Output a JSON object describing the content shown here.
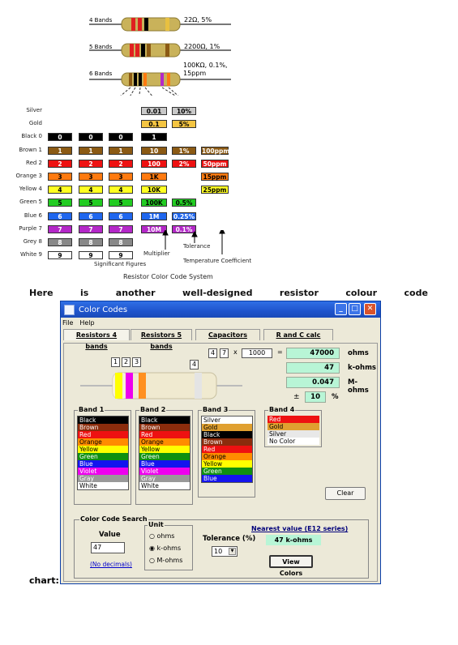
{
  "figure": {
    "bands_rows": [
      {
        "label": "4 Bands",
        "value": "22Ω, 5%"
      },
      {
        "label": "5 Bands",
        "value": "2200Ω, 1%"
      },
      {
        "label": "6 Bands",
        "value": "100KΩ, 0.1%, 15ppm"
      }
    ],
    "table_rows": [
      {
        "label": "Silver",
        "color": "#c8c8c8",
        "sig": [
          "",
          "",
          ""
        ],
        "mult": "0.01",
        "tol": "10%",
        "tc": ""
      },
      {
        "label": "Gold",
        "color": "#f4c542",
        "sig": [
          "",
          "",
          ""
        ],
        "mult": "0.1",
        "tol": "5%",
        "tc": ""
      },
      {
        "label": "Black 0",
        "color": "#000000",
        "sig": [
          "0",
          "0",
          "0"
        ],
        "mult": "1",
        "tol": "",
        "tc": ""
      },
      {
        "label": "Brown 1",
        "color": "#8b5a14",
        "sig": [
          "1",
          "1",
          "1"
        ],
        "mult": "10",
        "tol": "1%",
        "tc": "100ppm"
      },
      {
        "label": "Red 2",
        "color": "#ee1111",
        "sig": [
          "2",
          "2",
          "2"
        ],
        "mult": "100",
        "tol": "2%",
        "tc": "50ppm"
      },
      {
        "label": "Orange 3",
        "color": "#ff7a10",
        "sig": [
          "3",
          "3",
          "3"
        ],
        "mult": "1K",
        "tol": "",
        "tc": "15ppm"
      },
      {
        "label": "Yellow 4",
        "color": "#ffff22",
        "sig": [
          "4",
          "4",
          "4"
        ],
        "mult": "10K",
        "tol": "",
        "tc": "25ppm"
      },
      {
        "label": "Green 5",
        "color": "#22cc22",
        "sig": [
          "5",
          "5",
          "5"
        ],
        "mult": "100K",
        "tol": "0.5%",
        "tc": ""
      },
      {
        "label": "Blue 6",
        "color": "#1f66ee",
        "sig": [
          "6",
          "6",
          "6"
        ],
        "mult": "1M",
        "tol": "0.25%",
        "tc": ""
      },
      {
        "label": "Purple 7",
        "color": "#b428c8",
        "sig": [
          "7",
          "7",
          "7"
        ],
        "mult": "10M",
        "tol": "0.1%",
        "tc": ""
      },
      {
        "label": "Grey 8",
        "color": "#888888",
        "sig": [
          "8",
          "8",
          "8"
        ],
        "mult": "",
        "tol": "",
        "tc": ""
      },
      {
        "label": "White 9",
        "color": "#ffffff",
        "sig": [
          "9",
          "9",
          "9"
        ],
        "mult": "",
        "tol": "",
        "tc": ""
      }
    ],
    "captions": {
      "significant": "Significant Figures",
      "multiplier": "Multiplier",
      "tolerance": "Tolerance",
      "temp": "Temperature Coefficient",
      "system": "Resistor Color Code System"
    }
  },
  "paragraph": {
    "words": [
      "Here",
      "is",
      "another",
      "well-designed",
      "resistor",
      "colour",
      "code"
    ],
    "last": "chart:"
  },
  "window": {
    "title": "Color Codes",
    "menu": [
      "File",
      "Help"
    ],
    "tabs": [
      "Resistors 4 bands",
      "Resistors 5 bands",
      "Capacitors",
      "R and C calc"
    ],
    "band_numbers": [
      "1",
      "2",
      "3",
      "4"
    ],
    "digits": [
      "4",
      "7"
    ],
    "times": "x",
    "multiplier": "1000",
    "equals": "=",
    "results": [
      {
        "value": "47000",
        "unit": "ohms"
      },
      {
        "value": "47",
        "unit": "k-ohms"
      },
      {
        "value": "0.047",
        "unit": "M-ohms"
      }
    ],
    "plusminus": "±",
    "tolerance_value": "10",
    "percent": "%",
    "band1": {
      "title": "Band 1",
      "items": [
        {
          "name": "Black",
          "bg": "#000000",
          "fg": "#ffffff"
        },
        {
          "name": "Brown",
          "bg": "#8b2c0c",
          "fg": "#ffffff"
        },
        {
          "name": "Red",
          "bg": "#ee1111",
          "fg": "#ffffff"
        },
        {
          "name": "Orange",
          "bg": "#ff8c00",
          "fg": "#000000"
        },
        {
          "name": "Yellow",
          "bg": "#ffff00",
          "fg": "#000000"
        },
        {
          "name": "Green",
          "bg": "#109010",
          "fg": "#ffffff"
        },
        {
          "name": "Blue",
          "bg": "#1414ee",
          "fg": "#ffffff"
        },
        {
          "name": "Violet",
          "bg": "#ee00ee",
          "fg": "#ffffff"
        },
        {
          "name": "Gray",
          "bg": "#999999",
          "fg": "#ffffff"
        },
        {
          "name": "White",
          "bg": "#ffffff",
          "fg": "#000000"
        }
      ]
    },
    "band2": {
      "title": "Band 2",
      "items": [
        {
          "name": "Black",
          "bg": "#000000",
          "fg": "#ffffff"
        },
        {
          "name": "Brown",
          "bg": "#8b2c0c",
          "fg": "#ffffff"
        },
        {
          "name": "Red",
          "bg": "#ee1111",
          "fg": "#ffffff"
        },
        {
          "name": "Orange",
          "bg": "#ff8c00",
          "fg": "#000000"
        },
        {
          "name": "Yellow",
          "bg": "#ffff00",
          "fg": "#000000"
        },
        {
          "name": "Green",
          "bg": "#109010",
          "fg": "#ffffff"
        },
        {
          "name": "Blue",
          "bg": "#1414ee",
          "fg": "#ffffff"
        },
        {
          "name": "Violet",
          "bg": "#ee00ee",
          "fg": "#ffffff"
        },
        {
          "name": "Gray",
          "bg": "#999999",
          "fg": "#ffffff"
        },
        {
          "name": "White",
          "bg": "#ffffff",
          "fg": "#000000"
        }
      ]
    },
    "band3": {
      "title": "Band 3",
      "items": [
        {
          "name": "Silver",
          "bg": "#ffffff",
          "fg": "#000000"
        },
        {
          "name": "Gold",
          "bg": "#e0a030",
          "fg": "#000000"
        },
        {
          "name": "Black",
          "bg": "#000000",
          "fg": "#ffffff"
        },
        {
          "name": "Brown",
          "bg": "#8b2c0c",
          "fg": "#ffffff"
        },
        {
          "name": "Red",
          "bg": "#ee1111",
          "fg": "#ffffff"
        },
        {
          "name": "Orange",
          "bg": "#ff8c00",
          "fg": "#000000"
        },
        {
          "name": "Yellow",
          "bg": "#ffff00",
          "fg": "#000000"
        },
        {
          "name": "Green",
          "bg": "#109010",
          "fg": "#ffffff"
        },
        {
          "name": "Blue",
          "bg": "#1414ee",
          "fg": "#ffffff"
        }
      ]
    },
    "band4": {
      "title": "Band 4",
      "items": [
        {
          "name": "Red",
          "bg": "#ee1111",
          "fg": "#ffffff"
        },
        {
          "name": "Gold",
          "bg": "#e0a030",
          "fg": "#000000"
        },
        {
          "name": "Silver",
          "bg": "#e8e8e8",
          "fg": "#000000"
        },
        {
          "name": "No Color",
          "bg": "#ffffff",
          "fg": "#000000"
        }
      ]
    },
    "clear_label": "Clear",
    "search": {
      "group_label": "Color Code Search",
      "value_label": "Value",
      "value": "47",
      "no_decimals": "(No decimals)",
      "unit_label": "Unit",
      "units": [
        "ohms",
        "k-ohms",
        "M-ohms"
      ],
      "selected_unit": "k-ohms",
      "tolerance_label": "Tolerance (%)",
      "tolerance": "10",
      "nearest_label": "Nearest value (E12 series)",
      "nearest": "47 k-ohms",
      "view_label": "View Colors"
    }
  }
}
